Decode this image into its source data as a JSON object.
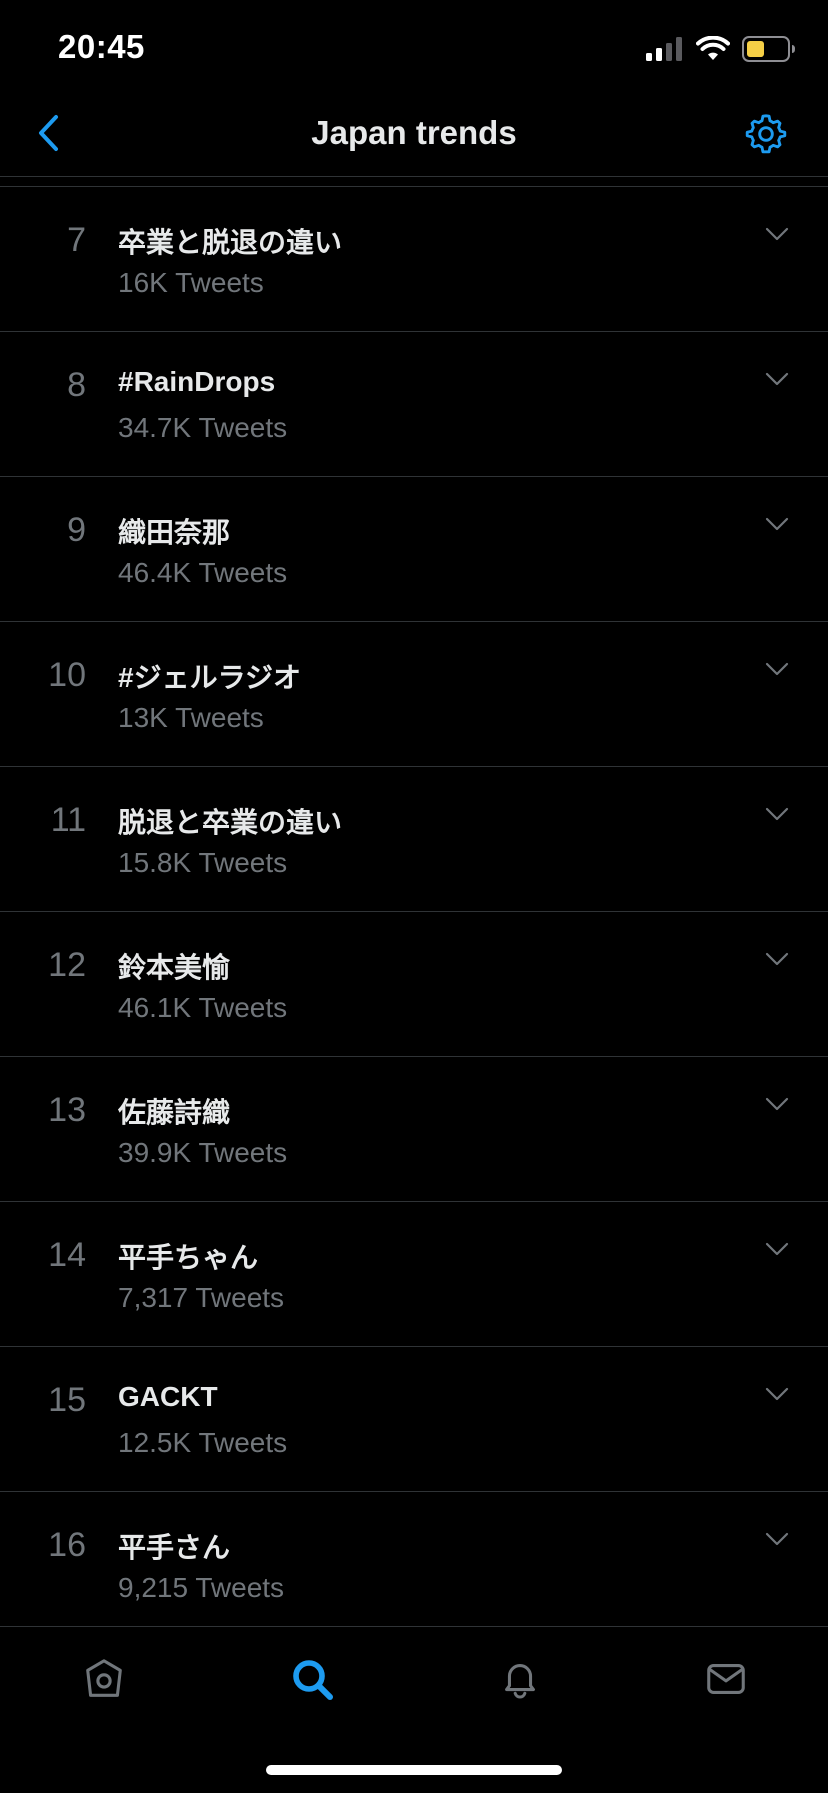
{
  "status_bar": {
    "time": "20:45",
    "signal_icon": "cellular-signal-icon",
    "wifi_icon": "wifi-icon",
    "battery_icon": "battery-icon",
    "battery_color": "#f5cf46"
  },
  "header": {
    "title": "Japan trends",
    "back_icon": "chevron-left-icon",
    "settings_icon": "gear-icon",
    "accent_color": "#1d9bf0"
  },
  "trends": [
    {
      "rank": "7",
      "name": "卒業と脱退の違い",
      "count": "16K Tweets"
    },
    {
      "rank": "8",
      "name": "#RainDrops",
      "count": "34.7K Tweets"
    },
    {
      "rank": "9",
      "name": "織田奈那",
      "count": "46.4K Tweets"
    },
    {
      "rank": "10",
      "name": "#ジェルラジオ",
      "count": "13K Tweets"
    },
    {
      "rank": "11",
      "name": "脱退と卒業の違い",
      "count": "15.8K Tweets"
    },
    {
      "rank": "12",
      "name": "鈴本美愉",
      "count": "46.1K Tweets"
    },
    {
      "rank": "13",
      "name": "佐藤詩織",
      "count": "39.9K Tweets"
    },
    {
      "rank": "14",
      "name": "平手ちゃん",
      "count": "7,317 Tweets"
    },
    {
      "rank": "15",
      "name": "GACKT",
      "count": "12.5K Tweets"
    },
    {
      "rank": "16",
      "name": "平手さん",
      "count": "9,215 Tweets"
    }
  ],
  "tab_bar": {
    "tabs": [
      {
        "icon": "home-icon",
        "active": false
      },
      {
        "icon": "search-icon",
        "active": true
      },
      {
        "icon": "bell-icon",
        "active": false
      },
      {
        "icon": "mail-icon",
        "active": false
      }
    ]
  }
}
